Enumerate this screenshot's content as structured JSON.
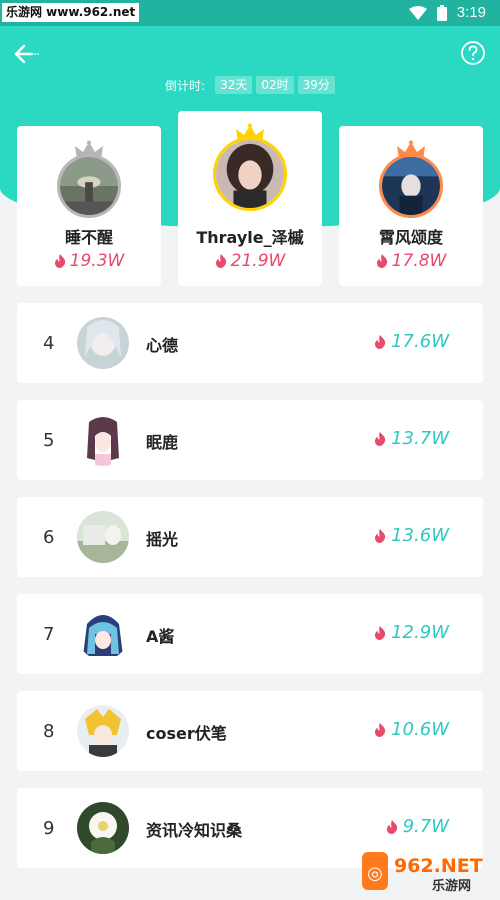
{
  "watermark": {
    "site": "乐游网 www.962.net",
    "logo_main": "962.NET",
    "logo_sub": "乐游网"
  },
  "status_bar": {
    "time": "3:19"
  },
  "countdown": {
    "label": "倒计时:",
    "days": "32天",
    "hours": "02时",
    "minutes": "39分"
  },
  "podium": [
    {
      "rank": 2,
      "name": "睡不醒",
      "score": "19.3W",
      "crown_color": "#b5b5b5"
    },
    {
      "rank": 1,
      "name": "Thrayle_泽槭",
      "score": "21.9W",
      "crown_color": "#ffd200"
    },
    {
      "rank": 3,
      "name": "霄风颂度",
      "score": "17.8W",
      "crown_color": "#ff8a4a"
    }
  ],
  "rankings": [
    {
      "rank": "4",
      "name": "心德",
      "score": "17.6W"
    },
    {
      "rank": "5",
      "name": "眠鹿",
      "score": "13.7W"
    },
    {
      "rank": "6",
      "name": "摇光",
      "score": "13.6W"
    },
    {
      "rank": "7",
      "name": "A酱",
      "score": "12.9W"
    },
    {
      "rank": "8",
      "name": "coser伏笔",
      "score": "10.6W"
    },
    {
      "rank": "9",
      "name": "资讯冷知识桑",
      "score": "9.7W"
    }
  ],
  "colors": {
    "accent": "#2bd9c3",
    "score_pink": "#e84a6a",
    "score_teal": "#2ec9c0"
  },
  "icons": [
    "back-arrow-icon",
    "help-icon",
    "crown-icon",
    "fire-icon",
    "wifi-icon",
    "battery-icon"
  ]
}
